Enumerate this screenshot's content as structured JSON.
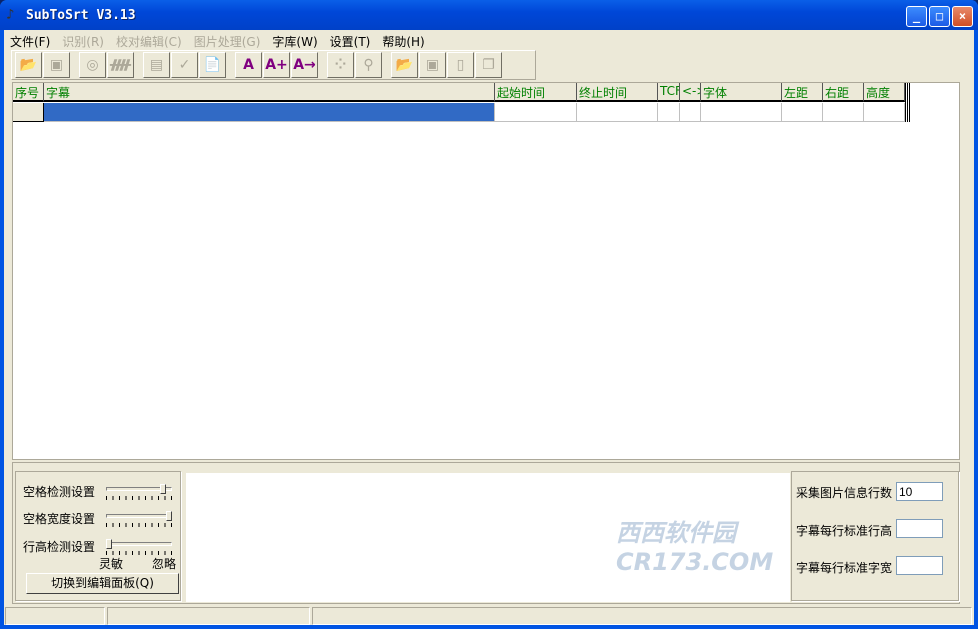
{
  "window": {
    "title": "SubToSrt V3.13",
    "minimize": "_",
    "maximize": "□",
    "close": "×"
  },
  "menu": [
    {
      "label": "文件(F)",
      "enabled": true
    },
    {
      "label": "识别(R)",
      "enabled": false
    },
    {
      "label": "校对编辑(C)",
      "enabled": false
    },
    {
      "label": "图片处理(G)",
      "enabled": false
    },
    {
      "label": "字库(W)",
      "enabled": true
    },
    {
      "label": "设置(T)",
      "enabled": true
    },
    {
      "label": "帮助(H)",
      "enabled": true
    }
  ],
  "toolbar": [
    {
      "icon": "open-video-icon",
      "glyph": "📂",
      "enabled": true
    },
    {
      "icon": "save-icon",
      "glyph": "▣",
      "enabled": false
    },
    {
      "icon": "recognize-icon",
      "glyph": "◎",
      "enabled": false
    },
    {
      "icon": "comb-icon",
      "glyph": "ᚎ",
      "enabled": false
    },
    {
      "icon": "image-icon",
      "glyph": "▤",
      "enabled": false
    },
    {
      "icon": "check-icon",
      "glyph": "✓",
      "enabled": false
    },
    {
      "icon": "document-settings-icon",
      "glyph": "📄",
      "enabled": true
    },
    {
      "icon": "font-edit-icon",
      "glyph": "A",
      "enabled": true,
      "color": "#800080"
    },
    {
      "icon": "font-add-icon",
      "glyph": "A+",
      "enabled": true,
      "color": "#800080"
    },
    {
      "icon": "font-export-icon",
      "glyph": "A→",
      "enabled": true,
      "color": "#800080"
    },
    {
      "icon": "dots-icon",
      "glyph": "⁘",
      "enabled": false
    },
    {
      "icon": "binoculars-icon",
      "glyph": "⚲",
      "enabled": false
    },
    {
      "icon": "open-subtitle-icon",
      "glyph": "📂",
      "enabled": true
    },
    {
      "icon": "save-subtitle-icon",
      "glyph": "▣",
      "enabled": false
    },
    {
      "icon": "new-icon",
      "glyph": "▯",
      "enabled": false
    },
    {
      "icon": "copy-icon",
      "glyph": "❐",
      "enabled": false
    }
  ],
  "grid": {
    "columns": [
      "序号",
      "字幕",
      "起始时间",
      "终止时间",
      "TCF",
      "<->",
      "字体",
      "左距",
      "右距",
      "高度"
    ],
    "header_color": "#008000",
    "selection_color": "#316ac5"
  },
  "settings": {
    "sliders": [
      {
        "label": "空格检测设置",
        "value": 0.9
      },
      {
        "label": "空格宽度设置",
        "value": 1.0
      },
      {
        "label": "行高检测设置",
        "value": 0.0
      }
    ],
    "scale_min": "灵敏",
    "scale_max": "忽略",
    "switch_button": "切换到编辑面板(Q)"
  },
  "info": {
    "sample_lines_label": "采集图片信息行数",
    "sample_lines_value": "10",
    "line_height_label": "字幕每行标准行高",
    "line_height_value": "",
    "char_width_label": "字幕每行标准字宽",
    "char_width_value": ""
  },
  "watermark": "西西软件园 CR173.COM"
}
